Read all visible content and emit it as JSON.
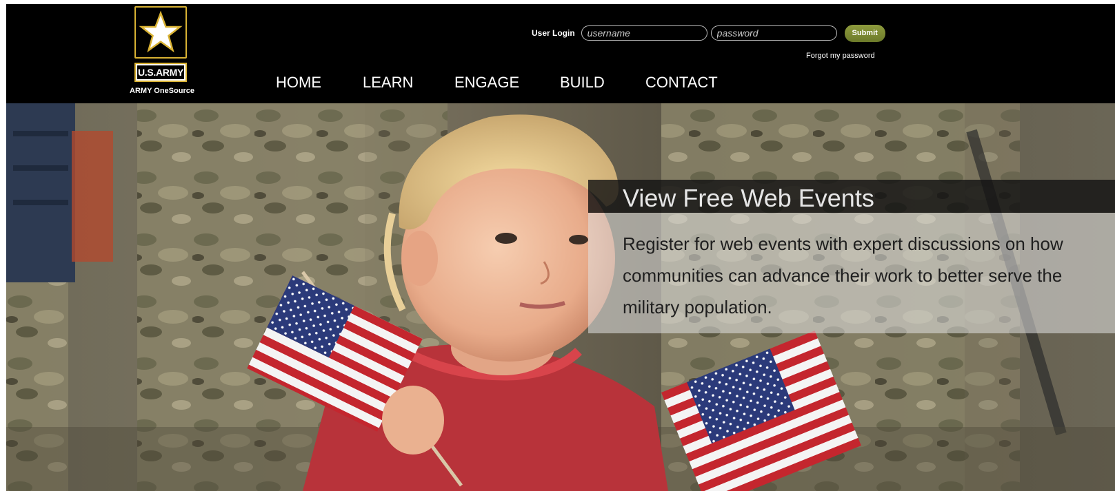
{
  "brand": {
    "logo_text": "U.S.ARMY",
    "subtitle": "ARMY OneSource",
    "star_icon": "star-icon",
    "accent_color": "#d9b233"
  },
  "login": {
    "label": "User Login",
    "username_placeholder": "username",
    "password_placeholder": "password",
    "submit_label": "Submit",
    "forgot_link": "Forgot my password",
    "submit_color": "#7a8832"
  },
  "nav": {
    "items": [
      {
        "label": "HOME"
      },
      {
        "label": "LEARN"
      },
      {
        "label": "ENGAGE"
      },
      {
        "label": "BUILD"
      },
      {
        "label": "CONTACT"
      }
    ]
  },
  "promo": {
    "title": "View Free Web Events",
    "body": "Register for web events with expert discussions on how communities can advance their work to better serve the military population."
  }
}
